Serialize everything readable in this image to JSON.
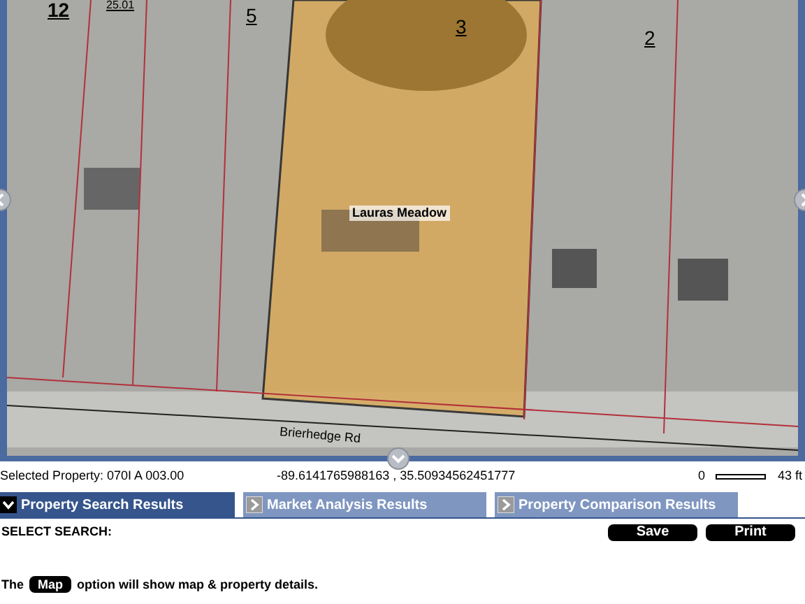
{
  "map": {
    "parcel_labels": [
      "12",
      "25.01",
      "5",
      "3",
      "2"
    ],
    "place_label": "Lauras Meadow",
    "road_label": "Brierhedge Rd"
  },
  "info_bar": {
    "selected_property": "Selected Property: 070I A 003.00",
    "coordinates": "-89.6141765988163 , 35.50934562451777",
    "scale_start": "0",
    "scale_end": "43 ft"
  },
  "tabs": [
    {
      "label": "Property Search Results",
      "selected": true
    },
    {
      "label": "Market Analysis Results",
      "selected": false
    },
    {
      "label": "Property Comparison Results",
      "selected": false
    }
  ],
  "panel": {
    "heading": "SELECT SEARCH:",
    "buttons": [
      "Save",
      "Print"
    ],
    "note_before": "The",
    "note_button": "Map",
    "note_after": "option will show map & property details."
  }
}
